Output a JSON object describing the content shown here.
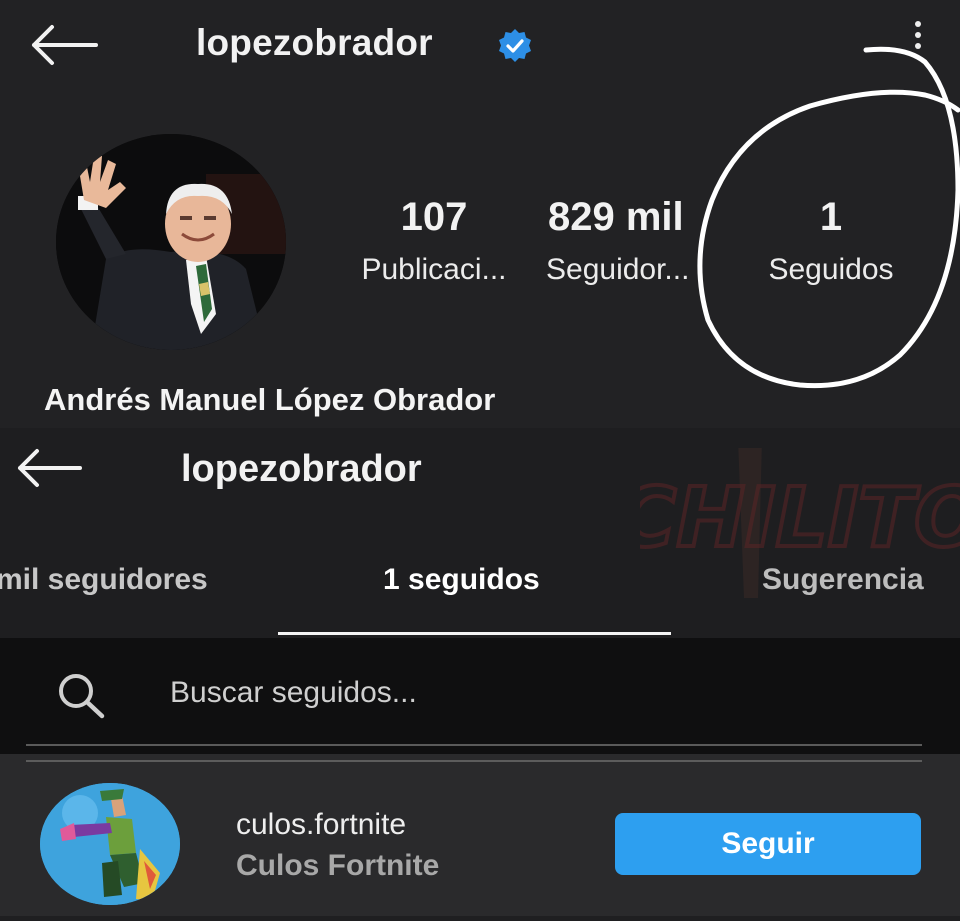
{
  "profile": {
    "username": "lopezobrador",
    "display_name": "Andrés Manuel López Obrador",
    "stats": [
      {
        "value": "107",
        "label": "Publicaci..."
      },
      {
        "value": "829 mil",
        "label": "Seguidor..."
      },
      {
        "value": "1",
        "label": "Seguidos"
      }
    ]
  },
  "following_screen": {
    "username": "lopezobrador",
    "tabs": [
      {
        "label": "mil seguidores"
      },
      {
        "label": "1 seguidos"
      },
      {
        "label": "Sugerencia"
      }
    ],
    "search_placeholder": "Buscar seguidos...",
    "items": [
      {
        "username": "culos.fortnite",
        "full_name": "Culos Fortnite",
        "button_label": "Seguir"
      }
    ]
  },
  "watermark_text": "CHILITO",
  "colors": {
    "background": "#1f1f21",
    "follow_button": "#2d9ff0",
    "verified_badge": "#2d8fe6",
    "annotation_circle": "#ffffff"
  },
  "icons": {
    "back": "arrow-left-icon",
    "verified": "verified-badge-icon",
    "more": "kebab-menu-icon",
    "search": "search-icon"
  }
}
